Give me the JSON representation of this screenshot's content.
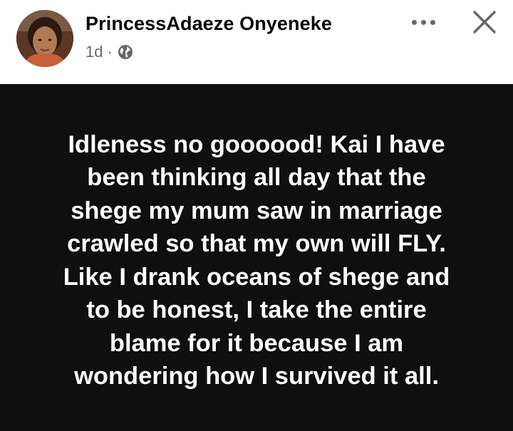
{
  "author": {
    "name": "PrincessAdaeze Onyeneke",
    "time": "1d",
    "separator": "·",
    "privacy_icon": "globe-icon"
  },
  "actions": {
    "more_icon": "more-horiz-icon",
    "close_icon": "close-icon"
  },
  "post": {
    "background_color": "#0f0f0f",
    "text_color": "#ffffff",
    "lines": [
      "Idleness no goooood! Kai I have",
      "been thinking all day that the",
      "shege my mum saw in marriage",
      "crawled so that my own will FLY.",
      "Like I drank oceans of shege and",
      "to be honest, I take the entire",
      "blame for it because I am",
      "wondering how I survived it all."
    ]
  }
}
